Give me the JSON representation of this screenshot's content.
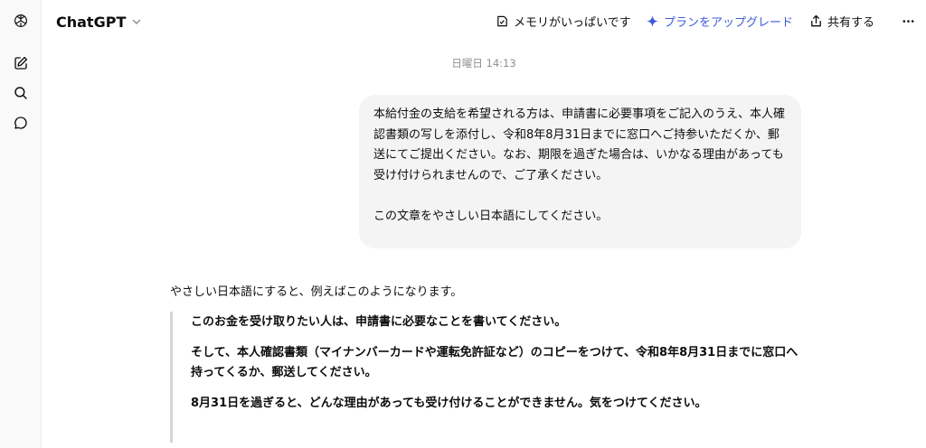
{
  "sidebar": {
    "items": [
      {
        "icon": "chatgpt-logo-icon"
      },
      {
        "icon": "new-chat-icon"
      },
      {
        "icon": "search-icon"
      },
      {
        "icon": "chat-bubble-icon"
      }
    ]
  },
  "header": {
    "model_name": "ChatGPT",
    "memory_label": "メモリがいっぱいです",
    "upgrade_label": "プランをアップグレード",
    "share_label": "共有する"
  },
  "conversation": {
    "timestamp": "日曜日 14:13",
    "user_message": {
      "paragraph1": "本給付金の支給を希望される方は、申請書に必要事項をご記入のうえ、本人確認書類の写しを添付し、令和8年8月31日までに窓口へご持参いただくか、郵送にてご提出ください。なお、期限を過ぎた場合は、いかなる理由があっても受け付けられませんので、ご了承ください。",
      "paragraph2": "この文章をやさしい日本語にしてください。"
    },
    "assistant_message": {
      "intro": "やさしい日本語にすると、例えばこのようになります。",
      "quote": [
        "このお金を受け取りたい人は、申請書に必要なことを書いてください。",
        "そして、本人確認書類（マイナンバーカードや運転免許証など）のコピーをつけて、令和8年8月31日までに窓口へ持ってくるか、郵送してください。",
        "8月31日を過ぎると、どんな理由があっても受け付けることができません。気をつけてください。"
      ]
    }
  },
  "colors": {
    "accent": "#3d5bd9",
    "bubble": "#f4f4f4",
    "sidebar_bg": "#f9f9f9"
  }
}
